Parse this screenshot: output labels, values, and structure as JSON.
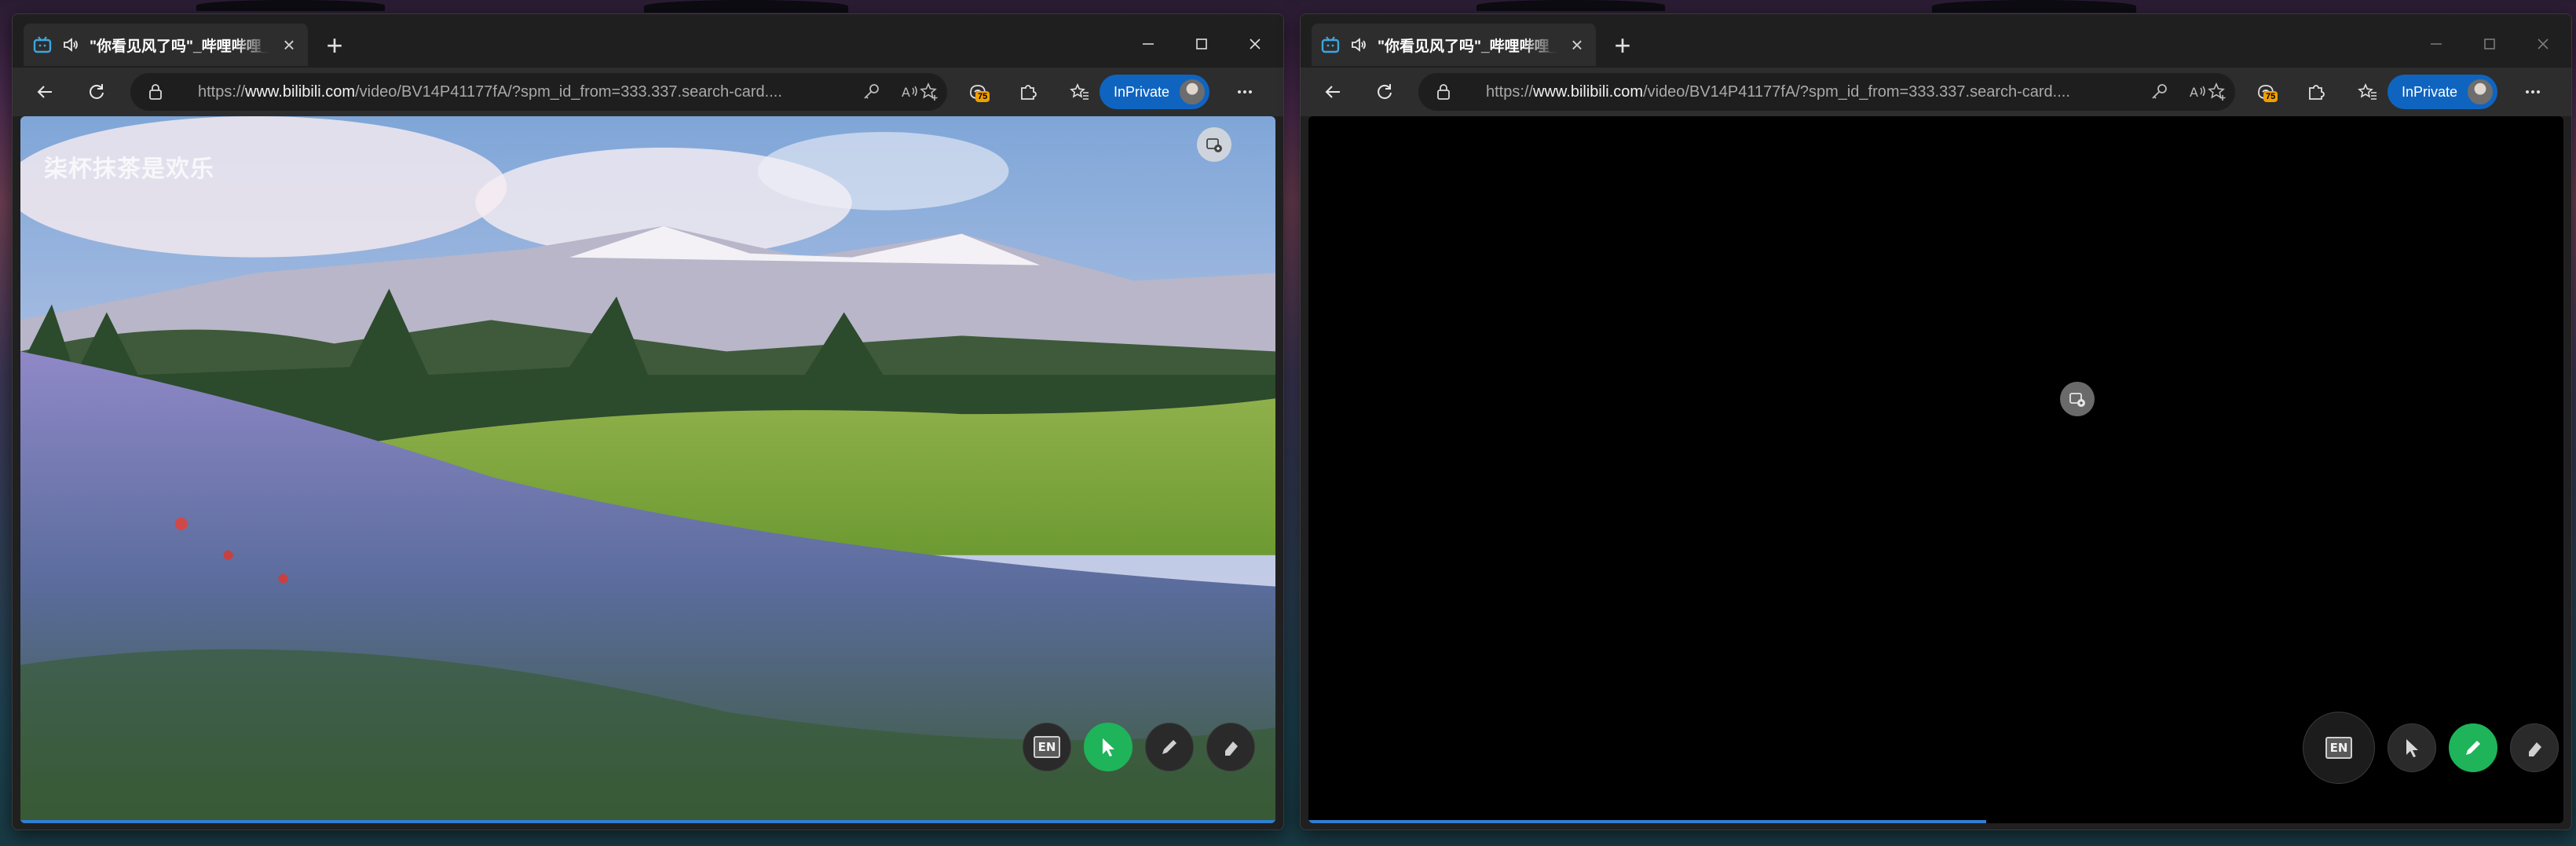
{
  "tab": {
    "title": "\"你看见风了吗\"_哔哩哔哩_b",
    "close_symbol": "×"
  },
  "new_tab_symbol": "+",
  "address_bar": {
    "url_prefix": "https://",
    "url_host": "www.bilibili.com",
    "url_rest": "/video/BV14P41177fA/?spm_id_from=333.337.search-card...."
  },
  "extensions_badge": "75",
  "inprivate_label": "InPrivate",
  "video": {
    "watermark": "柒杯抹茶是欢乐"
  },
  "ink_tools": {
    "en_label": "EN"
  },
  "icons": {
    "tab": "bilibili-tv-icon",
    "audio": "speaker-icon",
    "back": "arrow-left-icon",
    "refresh": "refresh-icon",
    "lock": "lock-icon",
    "key": "key-icon",
    "read_aloud": "read-aloud-icon",
    "add_fav": "star-plus-icon",
    "copilot": "copilot-icon",
    "extensions": "puzzle-icon",
    "favorites": "favorites-icon",
    "menu": "ellipsis-icon"
  },
  "colors": {
    "accent_blue": "#0f64c0",
    "active_ink": "#1fb45a",
    "chrome_dark": "#2d2d2d"
  }
}
